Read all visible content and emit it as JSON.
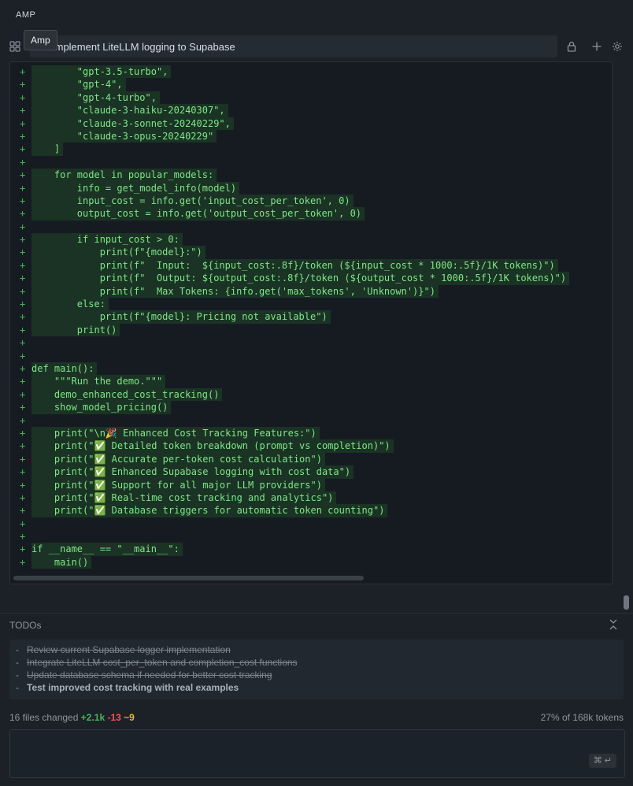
{
  "app": {
    "panel_name": "AMP",
    "tooltip": "Amp"
  },
  "thread": {
    "title": "Implement LiteLLM logging to Supabase"
  },
  "icons": {
    "grid": "grid-icon",
    "lock": "lock-icon",
    "plus": "plus-icon",
    "settings": "gear-icon",
    "collapse": "collapse-icon"
  },
  "code": {
    "gutter_marker": "+",
    "lines": [
      "        \"gpt-3.5-turbo\",",
      "        \"gpt-4\",",
      "        \"gpt-4-turbo\",",
      "        \"claude-3-haiku-20240307\",",
      "        \"claude-3-sonnet-20240229\",",
      "        \"claude-3-opus-20240229\"",
      "    ]",
      "",
      "    for model in popular_models:",
      "        info = get_model_info(model)",
      "        input_cost = info.get('input_cost_per_token', 0)",
      "        output_cost = info.get('output_cost_per_token', 0)",
      "",
      "        if input_cost > 0:",
      "            print(f\"{model}:\")",
      "            print(f\"  Input:  ${input_cost:.8f}/token (${input_cost * 1000:.5f}/1K tokens)\")",
      "            print(f\"  Output: ${output_cost:.8f}/token (${output_cost * 1000:.5f}/1K tokens)\")",
      "            print(f\"  Max Tokens: {info.get('max_tokens', 'Unknown')}\")",
      "        else:",
      "            print(f\"{model}: Pricing not available\")",
      "        print()",
      "",
      "",
      "def main():",
      "    \"\"\"Run the demo.\"\"\"",
      "    demo_enhanced_cost_tracking()",
      "    show_model_pricing()",
      "",
      "    print(\"\\n🎉 Enhanced Cost Tracking Features:\")",
      "    print(\"✅ Detailed token breakdown (prompt vs completion)\")",
      "    print(\"✅ Accurate per-token cost calculation\")",
      "    print(\"✅ Enhanced Supabase logging with cost data\")",
      "    print(\"✅ Support for all major LLM providers\")",
      "    print(\"✅ Real-time cost tracking and analytics\")",
      "    print(\"✅ Database triggers for automatic token counting\")",
      "",
      "",
      "if __name__ == \"__main__\":",
      "    main()"
    ]
  },
  "todos": {
    "title": "TODOs",
    "items": [
      {
        "text": "Review current Supabase logger implementation",
        "status": "done"
      },
      {
        "text": "Integrate LiteLLM cost_per_token and completion_cost functions",
        "status": "done"
      },
      {
        "text": "Update database schema if needed for better cost tracking",
        "status": "done"
      },
      {
        "text": "Test improved cost tracking with real examples",
        "status": "active"
      }
    ]
  },
  "status": {
    "files_changed": "16 files changed",
    "added": "+2.1k",
    "removed": "-13",
    "modified": "~9",
    "tokens": "27% of 168k tokens"
  },
  "input": {
    "submit_hint": "⌘ ↵"
  },
  "colors": {
    "added": "#3fb950",
    "removed": "#f85149",
    "modified": "#e3b341",
    "code": "#7ee787"
  }
}
